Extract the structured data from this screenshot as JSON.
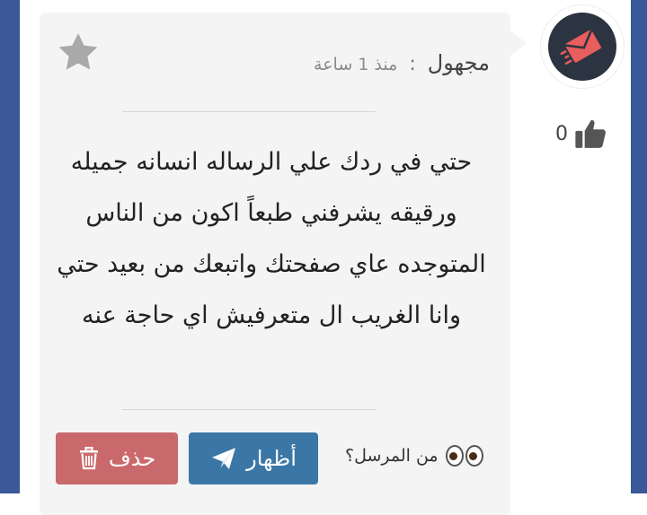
{
  "post": {
    "author": "مجهول",
    "separator": ":",
    "time": "منذ 1 ساعة",
    "message": "حتي في ردك علي الرساله انسانه جميله ورقيقه يشرفني طبعاً اكون من الناس المتوجده عاي صفحتك واتبعك من بعيد حتي وانا الغريب ال متعرفيش اي حاجة عنه",
    "likes": "0"
  },
  "actions": {
    "sender_question": "من المرسل؟",
    "show_label": "أظهار",
    "delete_label": "حذف"
  },
  "icons": {
    "favorite": "star-icon",
    "avatar": "envelope-icon",
    "like": "thumbs-up-icon",
    "show": "paper-plane-icon",
    "delete": "trash-icon",
    "sender": "eyes-icon"
  },
  "colors": {
    "frame": "#3b5998",
    "delete_button": "#c9696c",
    "show_button": "#3b77a6",
    "card": "#f4f4f4",
    "avatar_bg": "#2b3440",
    "avatar_accent": "#e85d5d"
  }
}
